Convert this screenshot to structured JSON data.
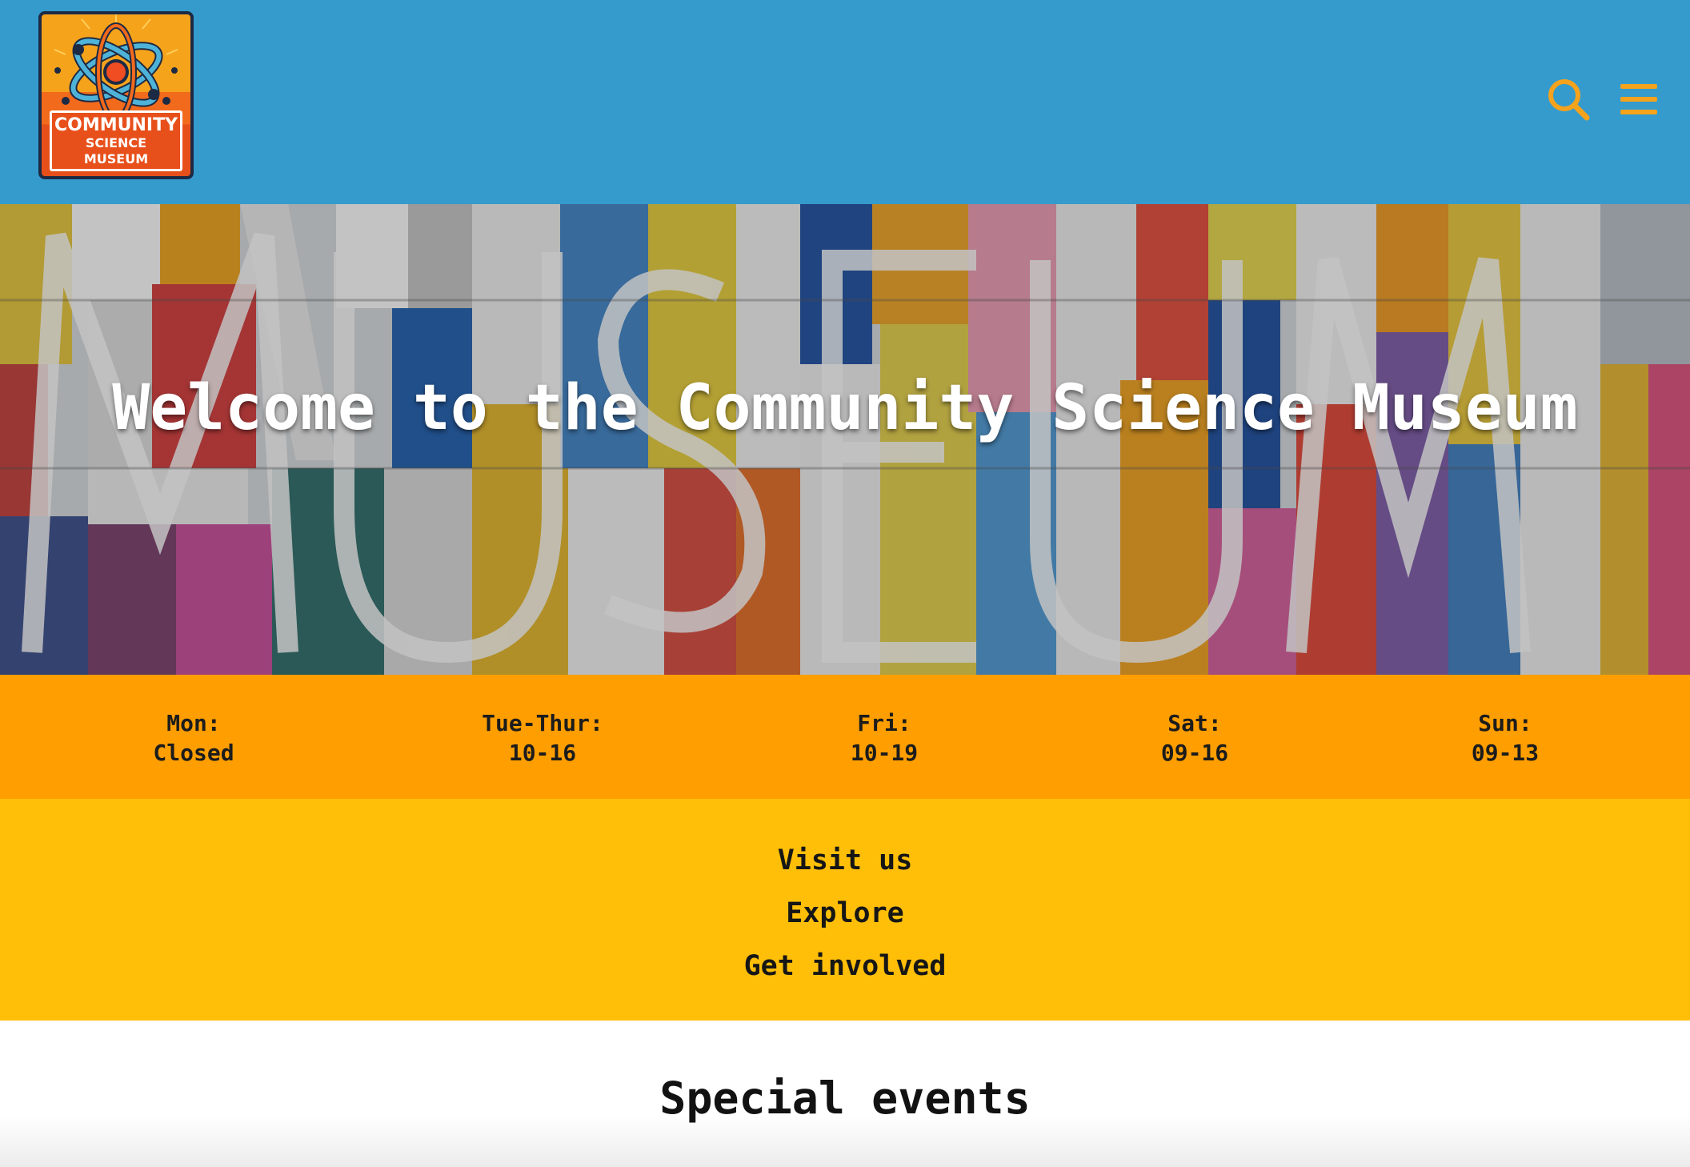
{
  "header": {
    "logo": {
      "line1": "COMMUNITY",
      "line2": "SCIENCE MUSEUM",
      "icon": "atom-icon"
    },
    "search_icon": "search-icon",
    "menu_icon": "hamburger-menu-icon",
    "background_color": "#359bcc",
    "icon_color": "#f5a21c"
  },
  "hero": {
    "title": "Welcome to the Community Science Museum",
    "background_image": "colorful-museum-facade"
  },
  "hours": [
    {
      "day": "Mon:",
      "time": "Closed"
    },
    {
      "day": "Tue-Thur:",
      "time": "10-16"
    },
    {
      "day": "Fri:",
      "time": "10-19"
    },
    {
      "day": "Sat:",
      "time": "09-16"
    },
    {
      "day": "Sun:",
      "time": "09-13"
    }
  ],
  "nav": {
    "items": [
      "Visit us",
      "Explore",
      "Get involved"
    ]
  },
  "events": {
    "heading": "Special events"
  },
  "colors": {
    "hours_bg": "#ff9e00",
    "nav_bg": "#ffbf08"
  }
}
